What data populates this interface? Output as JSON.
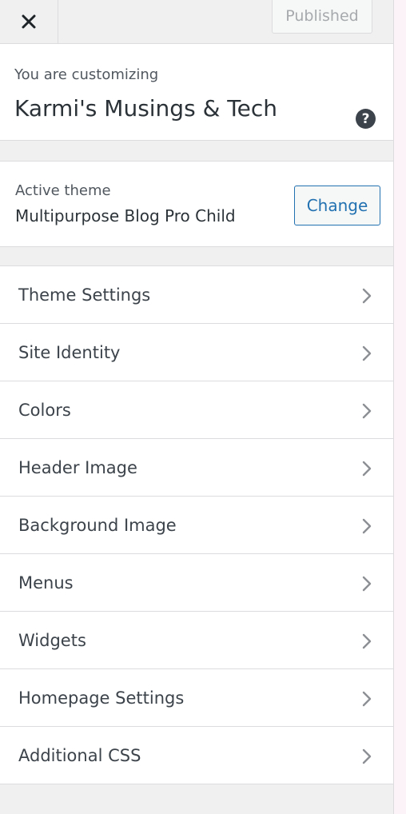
{
  "header": {
    "close_icon": "close-icon",
    "published_label": "Published"
  },
  "info": {
    "customizing_label": "You are customizing",
    "site_title": "Karmi's Musings & Tech",
    "help_icon": "question-mark-icon",
    "help_glyph": "?"
  },
  "theme": {
    "active_label": "Active theme",
    "name": "Multipurpose Blog Pro Child",
    "change_label": "Change"
  },
  "menu": {
    "chevron_icon": "chevron-right-icon",
    "items": [
      {
        "label": "Theme Settings"
      },
      {
        "label": "Site Identity"
      },
      {
        "label": "Colors"
      },
      {
        "label": "Header Image"
      },
      {
        "label": "Background Image"
      },
      {
        "label": "Menus"
      },
      {
        "label": "Widgets"
      },
      {
        "label": "Homepage Settings"
      },
      {
        "label": "Additional CSS"
      }
    ]
  },
  "colors": {
    "accent": "#2271b1",
    "panel_bg": "#f0f0f1",
    "border": "#dcdcde"
  }
}
